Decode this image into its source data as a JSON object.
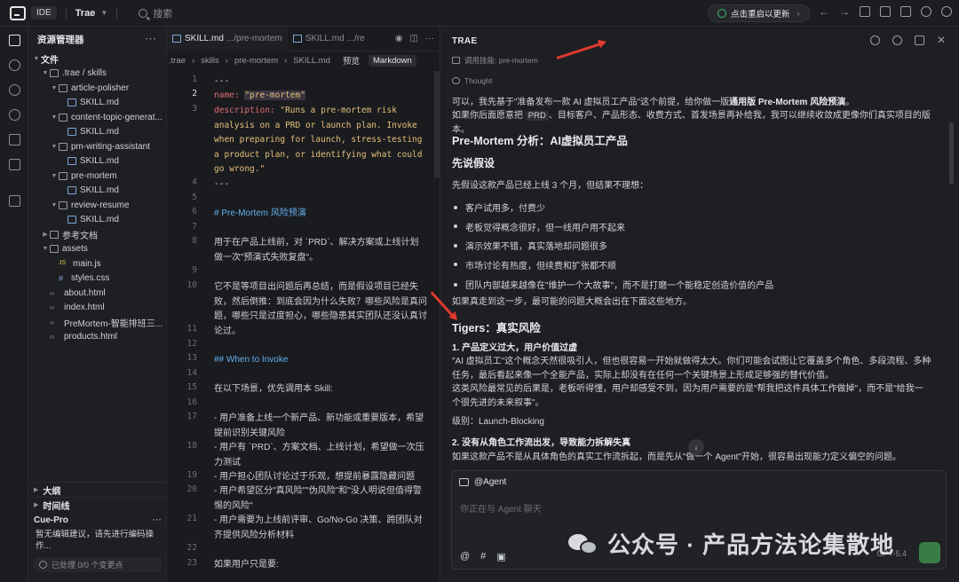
{
  "titlebar": {
    "mode": "IDE",
    "project": "Trae",
    "search": "搜索",
    "update": "点击重启以更新"
  },
  "explorer": {
    "title": "资源管理器",
    "root": "文件",
    "tree": [
      {
        "label": ".trae / skills",
        "type": "folder",
        "depth": 1,
        "open": true
      },
      {
        "label": "article-polisher",
        "type": "folder",
        "depth": 2,
        "open": true
      },
      {
        "label": "SKILL.md",
        "type": "md",
        "depth": 3
      },
      {
        "label": "content-topic-generat...",
        "type": "folder",
        "depth": 2,
        "open": true
      },
      {
        "label": "SKILL.md",
        "type": "md",
        "depth": 3
      },
      {
        "label": "pm-writing-assistant",
        "type": "folder",
        "depth": 2,
        "open": true
      },
      {
        "label": "SKILL.md",
        "type": "md",
        "depth": 3
      },
      {
        "label": "pre-mortem",
        "type": "folder",
        "depth": 2,
        "open": true
      },
      {
        "label": "SKILL.md",
        "type": "md",
        "depth": 3
      },
      {
        "label": "review-resume",
        "type": "folder",
        "depth": 2,
        "open": true
      },
      {
        "label": "SKILL.md",
        "type": "md",
        "depth": 3
      },
      {
        "label": "参考文档",
        "type": "folder",
        "depth": 1,
        "open": false
      },
      {
        "label": "assets",
        "type": "folder",
        "depth": 1,
        "open": true
      },
      {
        "label": "main.js",
        "type": "js",
        "depth": 2
      },
      {
        "label": "styles.css",
        "type": "css",
        "depth": 2
      },
      {
        "label": "about.html",
        "type": "html",
        "depth": 1
      },
      {
        "label": "index.html",
        "type": "html",
        "depth": 1
      },
      {
        "label": "PreMortem-智能排班三...",
        "type": "html",
        "depth": 1
      },
      {
        "label": "products.html",
        "type": "html",
        "depth": 1
      }
    ],
    "sections": {
      "outline": "大纲",
      "timeline": "时间线"
    },
    "cue": {
      "title": "Cue-Pro",
      "text": "暂无编辑建议，请先进行编码操作...",
      "status": "已处理 0/0 个变更点"
    }
  },
  "editor": {
    "tabs": [
      {
        "name": "SKILL.md",
        "dir": ".../pre-mortem",
        "active": true
      },
      {
        "name": "SKILL.md",
        "dir": ".../re",
        "active": false
      }
    ],
    "breadcrumb": [
      ".trae",
      "skills",
      "pre-mortem",
      "SKILL.md"
    ],
    "preview": "预览",
    "markdown": "Markdown",
    "line_numbers": [
      "1",
      "2",
      "3",
      "",
      "",
      "",
      "4",
      "5",
      "6",
      "7",
      "8",
      "",
      "9",
      "10",
      "",
      "",
      "11",
      "12",
      "13",
      "14",
      "15",
      "16",
      "",
      "17",
      "",
      "18",
      "19",
      "",
      "20",
      "",
      "21",
      "22",
      "23"
    ]
  },
  "code": {
    "l1": "---",
    "l2_key": "name: ",
    "l2_val": "\"pre-mortem\"",
    "l3_key": "description: ",
    "l3_val": "\"Runs a pre-mortem risk analysis on a PRD or launch plan. Invoke when preparing for launch, stress-testing a product plan, or identifying what could go wrong.\"",
    "l4": "---",
    "l6": "# Pre-Mortem 风险预演",
    "l8": "用于在产品上线前，对 `PRD`、解决方案或上线计划做一次\"预演式失败复盘\"。",
    "l10": "它不是等项目出问题后再总结，而是假设项目已经失败，然后倒推：到底会因为什么失败？哪些风险是真问题，哪些只是过度担心，哪些隐患其实团队还没认真讨论过。",
    "l12": "## When to Invoke",
    "l14": "在以下场景，优先调用本 Skill:",
    "l16": "- 用户准备上线一个新产品、新功能或重要版本，希望提前识别关键风险",
    "l17": "- 用户有 `PRD`、方案文档、上线计划，希望做一次压力测试",
    "l18": "- 用户担心团队讨论过于乐观，想提前暴露隐藏问题",
    "l19": "- 用户希望区分\"真风险\"\"伪风险\"和\"没人明说但值得警惕的风险\"",
    "l20": "- 用户需要为上线前评审、Go/No-Go 决策、跨团队对齐提供风险分析材料",
    "l22": "如果用户只是要:"
  },
  "chat": {
    "title": "TRAE",
    "skill_call": "调用技能: pre-mortem",
    "thought": "Thought",
    "intro1_a": "可以，我先基于\"准备发布一款 AI 虚拟员工产品\"这个前提，给你做一版",
    "intro1_b": "通用版 Pre-Mortem 风险预演",
    "intro1_c": "。",
    "intro2_a": "如果你后面愿意把 ",
    "intro2_code": "PRD",
    "intro2_b": "、目标客户、产品形态、收费方式、首发场景再补给我，我可以继续收敛成更像你们真实项目的版本。",
    "h1": "Pre-Mortem 分析：AI虚拟员工产品",
    "h2": "先说假设",
    "assume": "先假设这款产品已经上线 3 个月，但结果不理想：",
    "bullets": [
      "客户试用多，付费少",
      "老板觉得概念很好，但一线用户用不起来",
      "演示效果不错，真实落地却问题很多",
      "市场讨论有热度，但续费和扩张都不顺",
      "团队内部越来越像在\"维护一个大故事\"，而不是打磨一个能稳定创造价值的产品"
    ],
    "conclusion": "如果真走到这一步，最可能的问题大概会出在下面这些地方。",
    "h3": "Tigers：真实风险",
    "r1_title": "1. 产品定义过大，用户价值过虚",
    "r1_body": "\"AI 虚拟员工\"这个概念天然很吸引人，但也很容易一开始就做得太大。你们可能会试图让它覆盖多个角色、多段流程、多种任务，最后看起来像一个全能产品，实际上却没有在任何一个关键场景上形成足够强的替代价值。",
    "r1_body2": "这类风险最常见的后果是，老板听得懂，用户却感受不到，因为用户需要的是\"帮我把这件具体工作做掉\"，而不是\"给我一个很先进的未来叙事\"。",
    "r1_level": "级别：Launch-Blocking",
    "r2_title": "2. 没有从角色工作流出发，导致能力拆解失真",
    "r2_body": "如果这款产品不是从具体角色的真实工作流拆起，而是先从\"做一个 Agent\"开始，很容易出现能力定义偏空的问题。",
    "input_tag": "@Agent",
    "input_placeholder": "你正在与 Agent 聊天",
    "input_tools": [
      "@",
      "#",
      "▣"
    ],
    "model": "GPT-5.4"
  },
  "watermark": "公众号 · 产品方法论集散地",
  "colors": {
    "accent_green": "#3fbf6a",
    "arrow_red": "#e0392f",
    "bg": "#1a1b1e"
  }
}
